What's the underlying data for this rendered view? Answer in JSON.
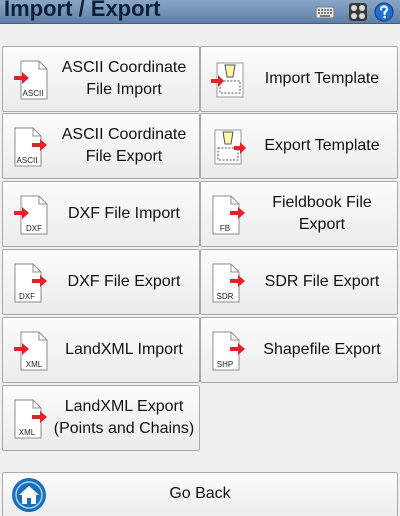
{
  "header": {
    "title": "Import / Export",
    "icons": [
      "keyboard-icon",
      "calculator-icon",
      "help-icon"
    ],
    "title_color": "#0d1f3a",
    "bar_color": "#7390b5"
  },
  "buttons": [
    {
      "id": "ascii-coordinate-file-import",
      "label": "ASCII Coordinate File Import",
      "icon": "ascii-import-icon",
      "badge": "ASCII"
    },
    {
      "id": "import-template",
      "label": "Import Template",
      "icon": "import-template-icon",
      "badge": ""
    },
    {
      "id": "ascii-coordinate-file-export",
      "label": "ASCII Coordinate File Export",
      "icon": "ascii-export-icon",
      "badge": "ASCII"
    },
    {
      "id": "export-template",
      "label": "Export Template",
      "icon": "export-template-icon",
      "badge": ""
    },
    {
      "id": "dxf-file-import",
      "label": "DXF File Import",
      "icon": "dxf-import-icon",
      "badge": "DXF"
    },
    {
      "id": "fieldbook-file-export",
      "label": "Fieldbook File Export",
      "icon": "fieldbook-export-icon",
      "badge": "FB"
    },
    {
      "id": "dxf-file-export",
      "label": "DXF File Export",
      "icon": "dxf-export-icon",
      "badge": "DXF"
    },
    {
      "id": "sdr-file-export",
      "label": "SDR File Export",
      "icon": "sdr-export-icon",
      "badge": "SDR"
    },
    {
      "id": "landxml-import",
      "label": "LandXML Import",
      "icon": "landxml-import-icon",
      "badge": "XML"
    },
    {
      "id": "shapefile-export",
      "label": "Shapefile Export",
      "icon": "shapefile-export-icon",
      "badge": "SHP"
    },
    {
      "id": "landxml-export",
      "label": "LandXML Export (Points and Chains)",
      "icon": "landxml-export-icon",
      "badge": "XML"
    }
  ],
  "footer": {
    "go_back_label": "Go Back",
    "icon": "home-icon"
  },
  "colors": {
    "arrow": "#e8202a",
    "home_blue": "#1c6fb7",
    "button_border": "#a9a9a9"
  }
}
